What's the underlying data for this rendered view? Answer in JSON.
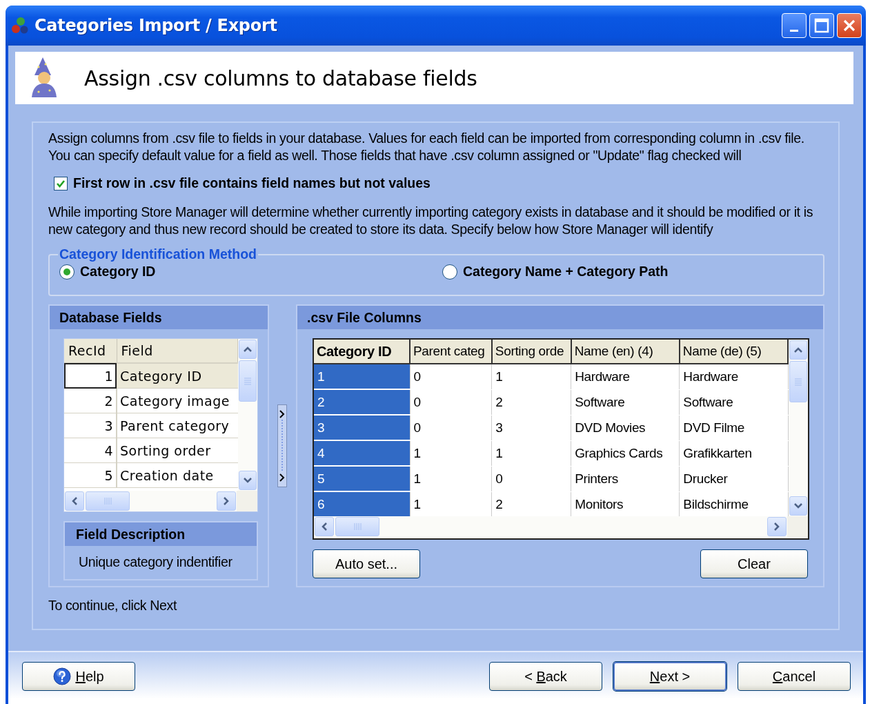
{
  "window": {
    "title": "Categories Import / Export"
  },
  "header": {
    "title": "Assign .csv columns to database fields"
  },
  "intro": "Assign columns from .csv file to fields in your database. Values for each field can be imported from corresponding column in .csv file. You can specify default value for a field as well. Those fields that have .csv column assigned or \"Update\" flag checked will",
  "first_row_checkbox": {
    "label": "First row in .csv file contains field names but not values",
    "checked": true
  },
  "identify_text": "While importing Store Manager will determine whether currently importing category exists in database and it should be modified or it is new category and thus new record should be created to store its data. Specify below how Store Manager will identify",
  "identification": {
    "title": "Category Identification Method",
    "options": [
      {
        "label": "Category ID",
        "selected": true
      },
      {
        "label": "Category Name + Category Path",
        "selected": false
      }
    ]
  },
  "database_fields": {
    "title": "Database Fields",
    "columns": [
      "RecId",
      "Field"
    ],
    "rows": [
      {
        "id": "1",
        "field": "Category ID",
        "selected": true
      },
      {
        "id": "2",
        "field": "Category image",
        "selected": false
      },
      {
        "id": "3",
        "field": "Parent category",
        "selected": false
      },
      {
        "id": "4",
        "field": "Sorting order",
        "selected": false
      },
      {
        "id": "5",
        "field": "Creation date",
        "selected": false
      }
    ]
  },
  "field_description": {
    "title": "Field Description",
    "text": "Unique category indentifier"
  },
  "csv_columns": {
    "title": ".csv File Columns",
    "columns": [
      {
        "label": "Category ID",
        "selected": true
      },
      {
        "label": "Parent categ",
        "selected": false
      },
      {
        "label": "Sorting orde",
        "selected": false
      },
      {
        "label": "Name (en) (4)",
        "selected": false
      },
      {
        "label": "Name (de) (5)",
        "selected": false
      }
    ],
    "rows": [
      [
        "1",
        "0",
        "1",
        "Hardware",
        "Hardware"
      ],
      [
        "2",
        "0",
        "2",
        "Software",
        "Software"
      ],
      [
        "3",
        "0",
        "3",
        "DVD Movies",
        "DVD Filme"
      ],
      [
        "4",
        "1",
        "1",
        "Graphics Cards",
        "Grafikkarten"
      ],
      [
        "5",
        "1",
        "0",
        "Printers",
        "Drucker"
      ],
      [
        "6",
        "1",
        "2",
        "Monitors",
        "Bildschirme"
      ]
    ],
    "buttons": [
      "Auto set...",
      "Clear"
    ]
  },
  "footer_hint": "To continue, click Next",
  "nav_buttons": [
    {
      "kind": "help",
      "key": "H",
      "post": "elp",
      "default": false
    },
    {
      "kind": "back",
      "pre": "< ",
      "key": "B",
      "post": "ack",
      "default": false
    },
    {
      "kind": "next",
      "key": "N",
      "post": "ext >",
      "default": true
    },
    {
      "kind": "cancel",
      "key": "C",
      "post": "ancel",
      "default": false
    }
  ]
}
